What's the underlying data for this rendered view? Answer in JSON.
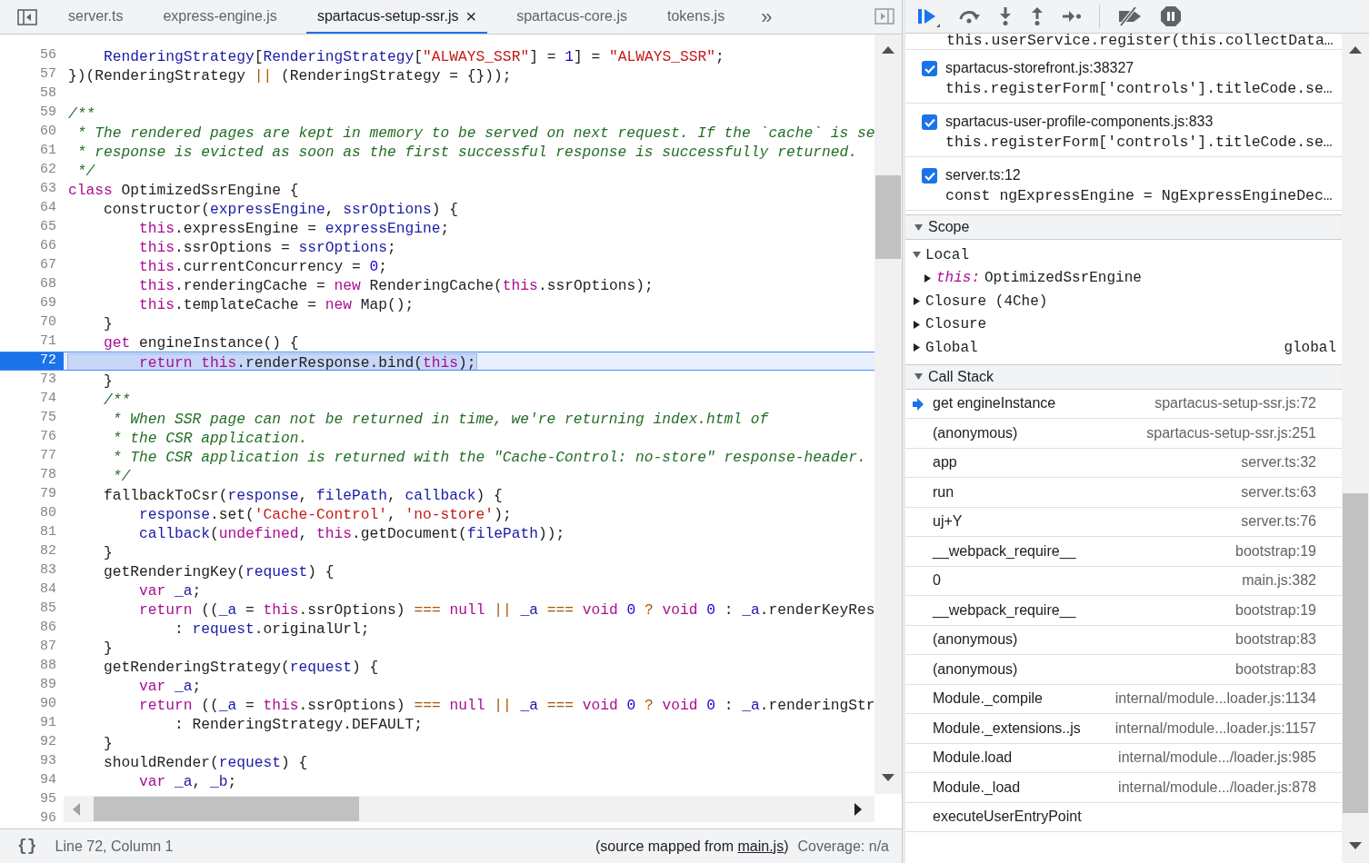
{
  "tabs": [
    {
      "label": "server.ts",
      "selected": false,
      "closable": false
    },
    {
      "label": "express-engine.js",
      "selected": false,
      "closable": false
    },
    {
      "label": "spartacus-setup-ssr.js",
      "selected": true,
      "closable": true
    },
    {
      "label": "spartacus-core.js",
      "selected": false,
      "closable": false
    },
    {
      "label": "tokens.js",
      "selected": false,
      "closable": false
    }
  ],
  "tab_overflow": "»",
  "tab_close": "×",
  "code_lines": [
    {
      "number": "56",
      "paused": false,
      "tokens": [
        {
          "kind": "variable",
          "text": "    RenderingStrategy"
        },
        {
          "kind": "plain",
          "text": "["
        },
        {
          "kind": "variable",
          "text": "RenderingStrategy"
        },
        {
          "kind": "plain",
          "text": "["
        },
        {
          "kind": "string",
          "text": "\"ALWAYS_SSR\""
        },
        {
          "kind": "plain",
          "text": "] = "
        },
        {
          "kind": "number",
          "text": "1"
        },
        {
          "kind": "plain",
          "text": "] = "
        },
        {
          "kind": "string",
          "text": "\"ALWAYS_SSR\""
        },
        {
          "kind": "plain",
          "text": ";"
        }
      ]
    },
    {
      "number": "57",
      "paused": false,
      "tokens": [
        {
          "kind": "plain",
          "text": "})(RenderingStrategy "
        },
        {
          "kind": "operator",
          "text": "||"
        },
        {
          "kind": "plain",
          "text": " (RenderingStrategy = {}));"
        }
      ]
    },
    {
      "number": "58",
      "paused": false
    },
    {
      "number": "59",
      "paused": false,
      "tokens": [
        {
          "kind": "comment",
          "text": "/**"
        }
      ]
    },
    {
      "number": "60",
      "paused": false,
      "tokens": [
        {
          "kind": "comment",
          "text": " * The rendered pages are kept in memory to be served on next request. If the `cache` is se"
        }
      ]
    },
    {
      "number": "61",
      "paused": false,
      "tokens": [
        {
          "kind": "comment",
          "text": " * response is evicted as soon as the first successful response is successfully returned."
        }
      ]
    },
    {
      "number": "62",
      "paused": false,
      "tokens": [
        {
          "kind": "comment",
          "text": " */"
        }
      ]
    },
    {
      "number": "63",
      "paused": false,
      "tokens": [
        {
          "kind": "keyword",
          "text": "class"
        },
        {
          "kind": "plain",
          "text": " OptimizedSsrEngine {"
        }
      ]
    },
    {
      "number": "64",
      "paused": false,
      "tokens": [
        {
          "kind": "plain",
          "text": "    constructor("
        },
        {
          "kind": "variable",
          "text": "expressEngine"
        },
        {
          "kind": "plain",
          "text": ", "
        },
        {
          "kind": "variable",
          "text": "ssrOptions"
        },
        {
          "kind": "plain",
          "text": ") {"
        }
      ]
    },
    {
      "number": "65",
      "paused": false,
      "tokens": [
        {
          "kind": "keyword",
          "text": "        this"
        },
        {
          "kind": "plain",
          "text": ".expressEngine = "
        },
        {
          "kind": "variable",
          "text": "expressEngine"
        },
        {
          "kind": "plain",
          "text": ";"
        }
      ]
    },
    {
      "number": "66",
      "paused": false,
      "tokens": [
        {
          "kind": "keyword",
          "text": "        this"
        },
        {
          "kind": "plain",
          "text": ".ssrOptions = "
        },
        {
          "kind": "variable",
          "text": "ssrOptions"
        },
        {
          "kind": "plain",
          "text": ";"
        }
      ]
    },
    {
      "number": "67",
      "paused": false,
      "tokens": [
        {
          "kind": "keyword",
          "text": "        this"
        },
        {
          "kind": "plain",
          "text": ".currentConcurrency = "
        },
        {
          "kind": "number",
          "text": "0"
        },
        {
          "kind": "plain",
          "text": ";"
        }
      ]
    },
    {
      "number": "68",
      "paused": false,
      "tokens": [
        {
          "kind": "keyword",
          "text": "        this"
        },
        {
          "kind": "plain",
          "text": ".renderingCache = "
        },
        {
          "kind": "keyword",
          "text": "new"
        },
        {
          "kind": "plain",
          "text": " RenderingCache("
        },
        {
          "kind": "keyword",
          "text": "this"
        },
        {
          "kind": "plain",
          "text": ".ssrOptions);"
        }
      ]
    },
    {
      "number": "69",
      "paused": false,
      "tokens": [
        {
          "kind": "keyword",
          "text": "        this"
        },
        {
          "kind": "plain",
          "text": ".templateCache = "
        },
        {
          "kind": "keyword",
          "text": "new"
        },
        {
          "kind": "plain",
          "text": " Map();"
        }
      ]
    },
    {
      "number": "70",
      "paused": false,
      "tokens": [
        {
          "kind": "plain",
          "text": "    }"
        }
      ]
    },
    {
      "number": "71",
      "paused": false,
      "tokens": [
        {
          "kind": "keyword",
          "text": "    get"
        },
        {
          "kind": "plain",
          "text": " engineInstance() {"
        }
      ]
    },
    {
      "number": "72",
      "paused": true,
      "tokens": [
        {
          "kind": "keyword",
          "text": "        return this"
        },
        {
          "kind": "plain",
          "text": ".renderResponse.bind("
        },
        {
          "kind": "keyword",
          "text": "this"
        },
        {
          "kind": "plain",
          "text": ");"
        }
      ]
    },
    {
      "number": "73",
      "paused": false,
      "tokens": [
        {
          "kind": "plain",
          "text": "    }"
        }
      ]
    },
    {
      "number": "74",
      "paused": false,
      "tokens": [
        {
          "kind": "comment",
          "text": "    /**"
        }
      ]
    },
    {
      "number": "75",
      "paused": false,
      "tokens": [
        {
          "kind": "comment",
          "text": "     * When SSR page can not be returned in time, we're returning index.html of"
        }
      ]
    },
    {
      "number": "76",
      "paused": false,
      "tokens": [
        {
          "kind": "comment",
          "text": "     * the CSR application."
        }
      ]
    },
    {
      "number": "77",
      "paused": false,
      "tokens": [
        {
          "kind": "comment",
          "text": "     * The CSR application is returned with the \"Cache-Control: no-store\" response-header."
        }
      ]
    },
    {
      "number": "78",
      "paused": false,
      "tokens": [
        {
          "kind": "comment",
          "text": "     */"
        }
      ]
    },
    {
      "number": "79",
      "paused": false,
      "tokens": [
        {
          "kind": "plain",
          "text": "    fallbackToCsr("
        },
        {
          "kind": "variable",
          "text": "response"
        },
        {
          "kind": "plain",
          "text": ", "
        },
        {
          "kind": "variable",
          "text": "filePath"
        },
        {
          "kind": "plain",
          "text": ", "
        },
        {
          "kind": "variable",
          "text": "callback"
        },
        {
          "kind": "plain",
          "text": ") {"
        }
      ]
    },
    {
      "number": "80",
      "paused": false,
      "tokens": [
        {
          "kind": "variable",
          "text": "        response"
        },
        {
          "kind": "plain",
          "text": ".set("
        },
        {
          "kind": "string",
          "text": "'Cache-Control'"
        },
        {
          "kind": "plain",
          "text": ", "
        },
        {
          "kind": "string",
          "text": "'no-store'"
        },
        {
          "kind": "plain",
          "text": ");"
        }
      ]
    },
    {
      "number": "81",
      "paused": false,
      "tokens": [
        {
          "kind": "variable",
          "text": "        callback"
        },
        {
          "kind": "plain",
          "text": "("
        },
        {
          "kind": "keyword",
          "text": "undefined"
        },
        {
          "kind": "plain",
          "text": ", "
        },
        {
          "kind": "keyword",
          "text": "this"
        },
        {
          "kind": "plain",
          "text": ".getDocument("
        },
        {
          "kind": "variable",
          "text": "filePath"
        },
        {
          "kind": "plain",
          "text": "));"
        }
      ]
    },
    {
      "number": "82",
      "paused": false,
      "tokens": [
        {
          "kind": "plain",
          "text": "    }"
        }
      ]
    },
    {
      "number": "83",
      "paused": false,
      "tokens": [
        {
          "kind": "plain",
          "text": "    getRenderingKey("
        },
        {
          "kind": "variable",
          "text": "request"
        },
        {
          "kind": "plain",
          "text": ") {"
        }
      ]
    },
    {
      "number": "84",
      "paused": false,
      "tokens": [
        {
          "kind": "keyword",
          "text": "        var"
        },
        {
          "kind": "variable",
          "text": " _a"
        },
        {
          "kind": "plain",
          "text": ";"
        }
      ]
    },
    {
      "number": "85",
      "paused": false,
      "tokens": [
        {
          "kind": "keyword",
          "text": "        return"
        },
        {
          "kind": "plain",
          "text": " (("
        },
        {
          "kind": "variable",
          "text": "_a"
        },
        {
          "kind": "plain",
          "text": " = "
        },
        {
          "kind": "keyword",
          "text": "this"
        },
        {
          "kind": "plain",
          "text": ".ssrOptions) "
        },
        {
          "kind": "operator",
          "text": "==="
        },
        {
          "kind": "keyword",
          "text": " null"
        },
        {
          "kind": "operator",
          "text": " ||"
        },
        {
          "kind": "variable",
          "text": " _a"
        },
        {
          "kind": "operator",
          "text": " ==="
        },
        {
          "kind": "keyword",
          "text": " void"
        },
        {
          "kind": "number",
          "text": " 0"
        },
        {
          "kind": "operator",
          "text": " ?"
        },
        {
          "kind": "keyword",
          "text": " void"
        },
        {
          "kind": "number",
          "text": " 0"
        },
        {
          "kind": "plain",
          "text": " : "
        },
        {
          "kind": "variable",
          "text": "_a"
        },
        {
          "kind": "plain",
          "text": ".renderKeyRes"
        }
      ]
    },
    {
      "number": "86",
      "paused": false,
      "tokens": [
        {
          "kind": "plain",
          "text": "            : "
        },
        {
          "kind": "variable",
          "text": "request"
        },
        {
          "kind": "plain",
          "text": ".originalUrl;"
        }
      ]
    },
    {
      "number": "87",
      "paused": false,
      "tokens": [
        {
          "kind": "plain",
          "text": "    }"
        }
      ]
    },
    {
      "number": "88",
      "paused": false,
      "tokens": [
        {
          "kind": "plain",
          "text": "    getRenderingStrategy("
        },
        {
          "kind": "variable",
          "text": "request"
        },
        {
          "kind": "plain",
          "text": ") {"
        }
      ]
    },
    {
      "number": "89",
      "paused": false,
      "tokens": [
        {
          "kind": "keyword",
          "text": "        var"
        },
        {
          "kind": "variable",
          "text": " _a"
        },
        {
          "kind": "plain",
          "text": ";"
        }
      ]
    },
    {
      "number": "90",
      "paused": false,
      "tokens": [
        {
          "kind": "keyword",
          "text": "        return"
        },
        {
          "kind": "plain",
          "text": " (("
        },
        {
          "kind": "variable",
          "text": "_a"
        },
        {
          "kind": "plain",
          "text": " = "
        },
        {
          "kind": "keyword",
          "text": "this"
        },
        {
          "kind": "plain",
          "text": ".ssrOptions) "
        },
        {
          "kind": "operator",
          "text": "==="
        },
        {
          "kind": "keyword",
          "text": " null"
        },
        {
          "kind": "operator",
          "text": " ||"
        },
        {
          "kind": "variable",
          "text": " _a"
        },
        {
          "kind": "operator",
          "text": " ==="
        },
        {
          "kind": "keyword",
          "text": " void"
        },
        {
          "kind": "number",
          "text": " 0"
        },
        {
          "kind": "operator",
          "text": " ?"
        },
        {
          "kind": "keyword",
          "text": " void"
        },
        {
          "kind": "number",
          "text": " 0"
        },
        {
          "kind": "plain",
          "text": " : "
        },
        {
          "kind": "variable",
          "text": "_a"
        },
        {
          "kind": "plain",
          "text": ".renderingStr"
        }
      ]
    },
    {
      "number": "91",
      "paused": false,
      "tokens": [
        {
          "kind": "plain",
          "text": "            : RenderingStrategy.DEFAULT;"
        }
      ]
    },
    {
      "number": "92",
      "paused": false,
      "tokens": [
        {
          "kind": "plain",
          "text": "    }"
        }
      ]
    },
    {
      "number": "93",
      "paused": false,
      "tokens": [
        {
          "kind": "plain",
          "text": "    shouldRender("
        },
        {
          "kind": "variable",
          "text": "request"
        },
        {
          "kind": "plain",
          "text": ") {"
        }
      ]
    },
    {
      "number": "94",
      "paused": false,
      "tokens": [
        {
          "kind": "keyword",
          "text": "        var"
        },
        {
          "kind": "variable",
          "text": " _a"
        },
        {
          "kind": "plain",
          "text": ", "
        },
        {
          "kind": "variable",
          "text": "_b"
        },
        {
          "kind": "plain",
          "text": ";"
        }
      ]
    },
    {
      "number": "95",
      "paused": false
    },
    {
      "number": "96",
      "paused": false
    }
  ],
  "status_bar": {
    "format_button": "{}",
    "position": "Line 72, Column 1",
    "source_map": {
      "prefix": "(source mapped from ",
      "link": "main.js",
      "suffix": ")"
    },
    "coverage": "Coverage: n/a"
  },
  "breakpoint_top_line": "this.userService.register(this.collectData…",
  "breakpoints": [
    {
      "location": "spartacus-storefront.js:38327",
      "code": "this.registerForm['controls'].titleCode.se…",
      "checked": true
    },
    {
      "location": "spartacus-user-profile-components.js:833",
      "code": "this.registerForm['controls'].titleCode.se…",
      "checked": true
    },
    {
      "location": "server.ts:12",
      "code": "const ngExpressEngine = NgExpressEngineDec…",
      "checked": true
    }
  ],
  "scope": {
    "title": "Scope",
    "expanded": true,
    "items": [
      {
        "label": "Local",
        "expanded": true,
        "children": [
          {
            "label": "this:",
            "value": "OptimizedSsrEngine",
            "expanded": false
          }
        ]
      },
      {
        "label": "Closure (4Che)",
        "expanded": false
      },
      {
        "label": "Closure",
        "expanded": false
      },
      {
        "label": "Global",
        "value": "global",
        "expanded": false
      }
    ]
  },
  "call_stack": {
    "title": "Call Stack",
    "expanded": true,
    "frames": [
      {
        "name": "get engineInstance",
        "location": "spartacus-setup-ssr.js:72",
        "selected": true
      },
      {
        "name": "(anonymous)",
        "location": "spartacus-setup-ssr.js:251",
        "selected": false
      },
      {
        "name": "app",
        "location": "server.ts:32",
        "selected": false
      },
      {
        "name": "run",
        "location": "server.ts:63",
        "selected": false
      },
      {
        "name": "uj+Y",
        "location": "server.ts:76",
        "selected": false
      },
      {
        "name": "__webpack_require__",
        "location": "bootstrap:19",
        "selected": false
      },
      {
        "name": "0",
        "location": "main.js:382",
        "selected": false
      },
      {
        "name": "__webpack_require__",
        "location": "bootstrap:19",
        "selected": false
      },
      {
        "name": "(anonymous)",
        "location": "bootstrap:83",
        "selected": false
      },
      {
        "name": "(anonymous)",
        "location": "bootstrap:83",
        "selected": false
      },
      {
        "name": "Module._compile",
        "location": "internal/module...loader.js:1134",
        "selected": false
      },
      {
        "name": "Module._extensions..js",
        "location": "internal/module...loader.js:1157",
        "selected": false
      },
      {
        "name": "Module.load",
        "location": "internal/module.../loader.js:985",
        "selected": false
      },
      {
        "name": "Module._load",
        "location": "internal/module.../loader.js:878",
        "selected": false
      },
      {
        "name": "executeUserEntryPoint",
        "selected": false
      }
    ]
  }
}
